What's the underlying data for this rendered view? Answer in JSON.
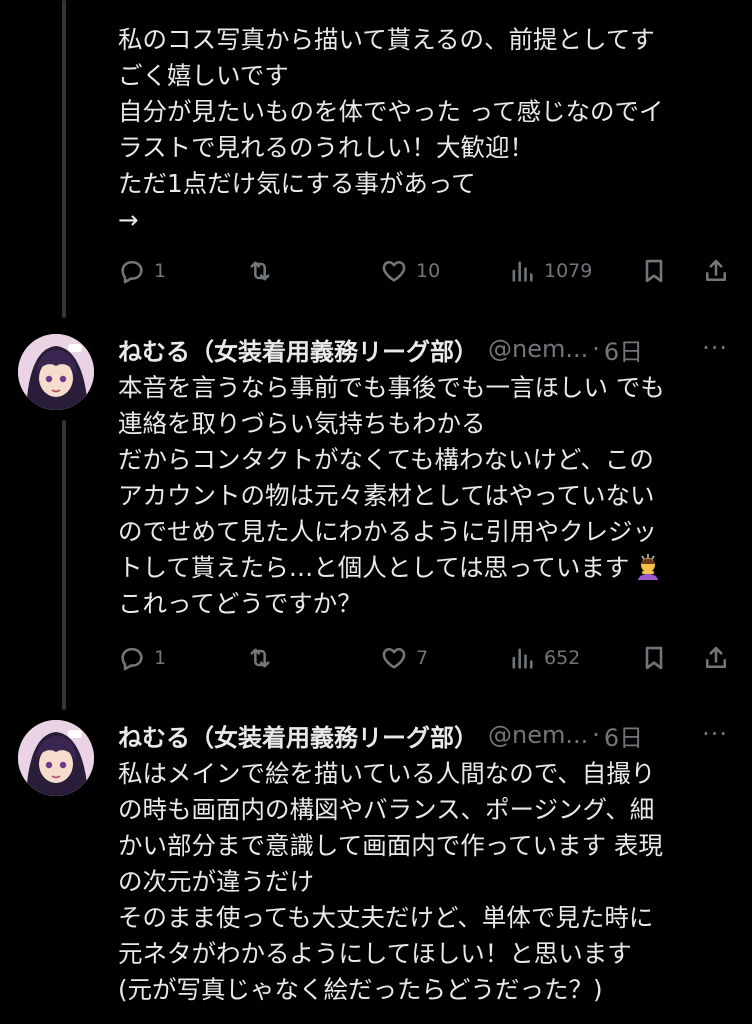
{
  "tweets": [
    {
      "lines": [
        "私のコス写真から描いて貰えるの、前提としてす",
        "ごく嬉しいです",
        "自分が見たいものを体でやった って感じなのでイ",
        "ラストで見れるのうれしい！大歓迎！",
        "ただ1点だけ気にする事があって",
        "→"
      ],
      "replies": "1",
      "reposts": "",
      "likes": "10",
      "views": "1079"
    },
    {
      "name": "ねむる（女装着用義務リーグ部）",
      "handle": "@nem...",
      "dot": "·",
      "date": "6日",
      "lines": [
        "本音を言うなら事前でも事後でも一言ほしい でも",
        "連絡を取りづらい気持ちもわかる",
        "だからコンタクトがなくても構わないけど、この",
        "アカウントの物は元々素材としてはやっていない",
        "のでせめて見た人にわかるように引用やクレジッ",
        "トして貰えたら…と個人としては思っています",
        "これってどうですか？"
      ],
      "emoji": "person-bowing-emoji",
      "replies": "1",
      "reposts": "",
      "likes": "7",
      "views": "652"
    },
    {
      "name": "ねむる（女装着用義務リーグ部）",
      "handle": "@nem...",
      "dot": "·",
      "date": "6日",
      "lines": [
        "私はメインで絵を描いている人間なので、自撮り",
        "の時も画面内の構図やバランス、ポージング、細",
        "かい部分まで意識して画面内で作っています 表現",
        "の次元が違うだけ",
        "そのまま使っても大丈夫だけど、単体で見た時に",
        "元ネタがわかるようにしてほしい！と思います",
        "(元が写真じゃなく絵だったらどうだった？)"
      ]
    }
  ],
  "icons": [
    "reply-icon",
    "repost-icon",
    "like-icon",
    "views-icon",
    "bookmark-icon",
    "share-icon",
    "more-icon"
  ],
  "colors": {
    "background": "#000000",
    "text": "#e7e9ea",
    "muted": "#71767b",
    "thread_line": "#333639"
  }
}
